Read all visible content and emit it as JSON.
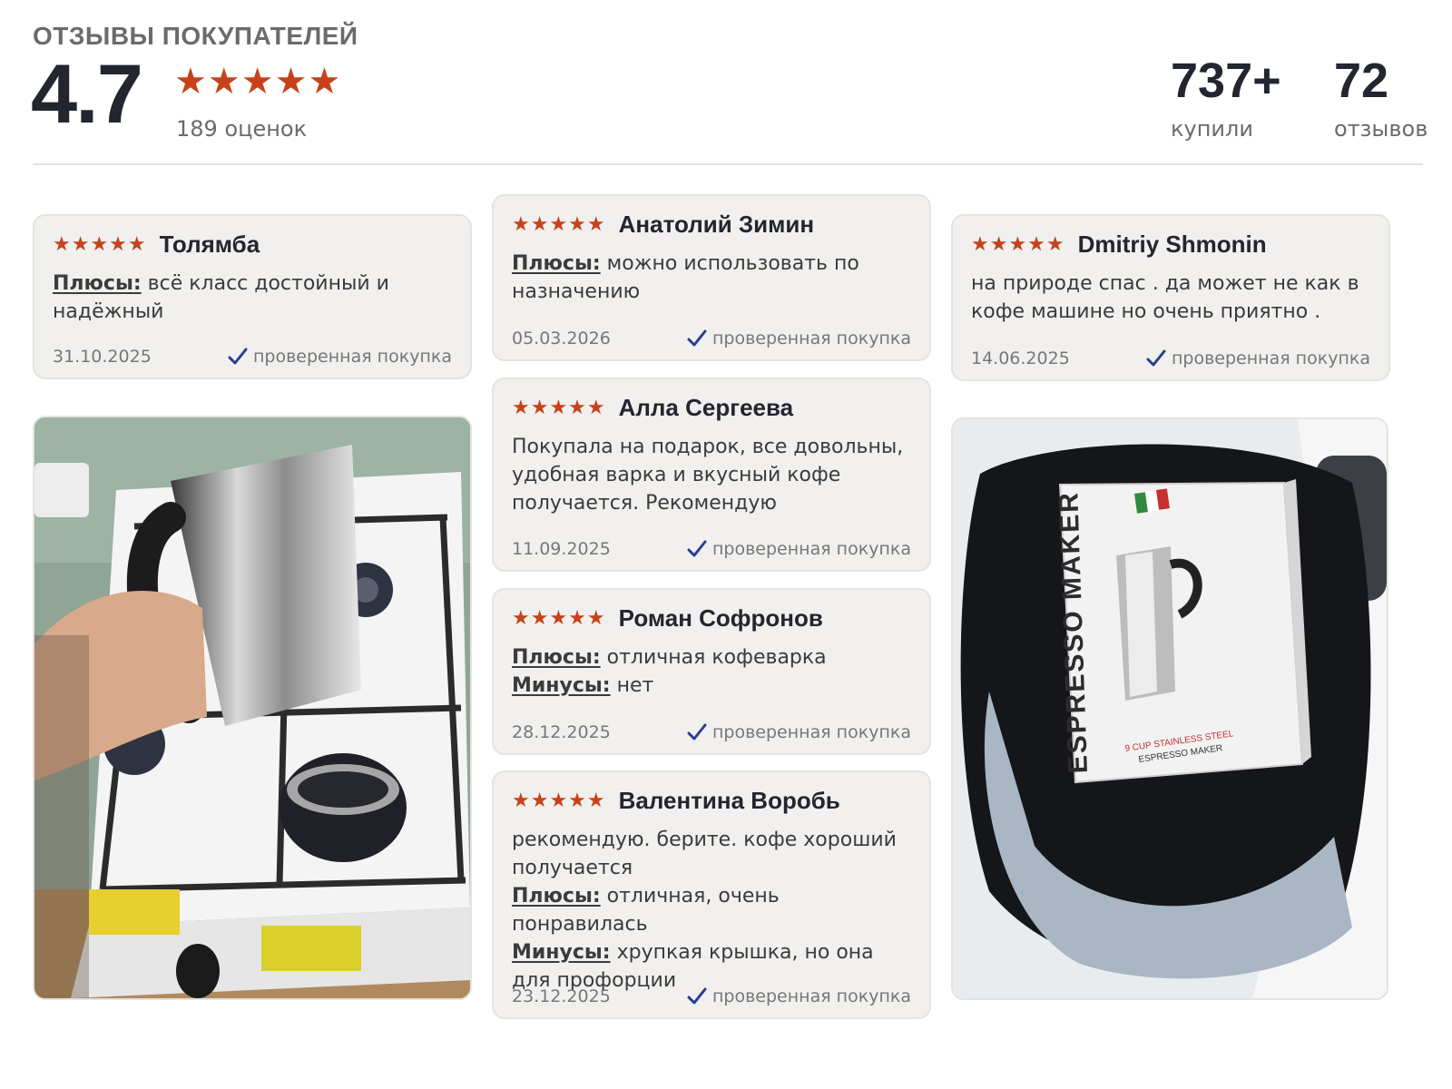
{
  "header": {
    "title": "ОТЗЫВЫ ПОКУПАТЕЛЕЙ",
    "rating": "4.7",
    "stars": "★★★★★",
    "ratings_count": "189 оценок",
    "bought_num": "737+",
    "bought_label": "купили",
    "reviews_num": "72",
    "reviews_label": "отзывов"
  },
  "colors": {
    "star": "#c7421a",
    "check": "#2a3e8c",
    "card_bg": "#f1f0ee"
  },
  "labels": {
    "pros": "Плюсы:",
    "cons": "Минусы:",
    "verified": "проверенная покупка",
    "stars": "★★★★★"
  },
  "reviews": [
    {
      "author": "Толямба",
      "pros": "всё класс достойный и надёжный",
      "date": "31.10.2025"
    },
    {
      "author": "Анатолий Зимин",
      "pros": "можно использовать по назначению",
      "date": "05.03.2026"
    },
    {
      "author": "Dmitriy Shmonin",
      "text": "на природе спас . да может не как в кофе машине но очень приятно .",
      "date": "14.06.2025"
    },
    {
      "author": "Алла Сергеева",
      "text": "Покупала на подарок, все довольны, удобная варка и вкусный кофе получается. Рекомендую",
      "date": "11.09.2025"
    },
    {
      "author": "Роман Софронов",
      "pros": "отличная кофеварка",
      "cons": "нет",
      "date": "28.12.2025"
    },
    {
      "author": "Валентина Воробь",
      "text": "рекомендую. берите. кофе хороший получается",
      "pros": "отличная, очень понравилась",
      "cons": "хрупкая крышка, но она для профорции",
      "date": "23.12.2025"
    }
  ],
  "photo_box": {
    "brand_text": "ESPRESSO MAKER",
    "caption_line1": "9 CUP STAINLESS STEEL",
    "caption_line2": "ESPRESSO MAKER"
  }
}
